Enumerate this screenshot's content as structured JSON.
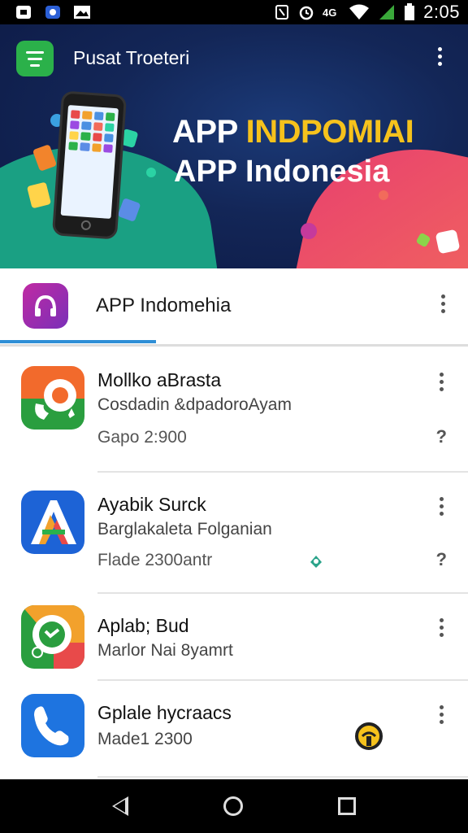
{
  "status_bar": {
    "time": "2:05",
    "icons": [
      "image-icon",
      "app-icon",
      "gallery-icon",
      "nfc-icon",
      "alarm-icon",
      "4g-icon",
      "wifi-icon",
      "signal-icon",
      "battery-icon"
    ]
  },
  "banner": {
    "title": "Pusat Troeteri",
    "hero_line1_part1": "APP",
    "hero_line1_part2": "INDPOMIAI",
    "hero_line2": "APP Indonesia"
  },
  "app_header": {
    "name": "APP Indomehia"
  },
  "apps": [
    {
      "title": "Mollko aBrasta",
      "subtitle": "Cosdadin &dpadoroAyam",
      "detail": "Gapo 2:900",
      "icon": "settings-phone-icon"
    },
    {
      "title": "Ayabik Surck",
      "subtitle": "Barglakaleta Folganian",
      "detail": "Flade 2300antr",
      "icon": "letter-a-icon"
    },
    {
      "title": "Aplab; Bud",
      "subtitle": "Marlor Nai 8yamrt",
      "detail": "",
      "icon": "chat-bubble-icon"
    },
    {
      "title": "Gplale hycraacs",
      "subtitle": "Made1 2300",
      "detail": "",
      "icon": "phone-icon"
    }
  ],
  "colors": {
    "accent_green": "#2bb14a",
    "tab_underline": "#2f8fd6",
    "banner_dark": "#132657",
    "hero_highlight": "#f6c21c"
  }
}
